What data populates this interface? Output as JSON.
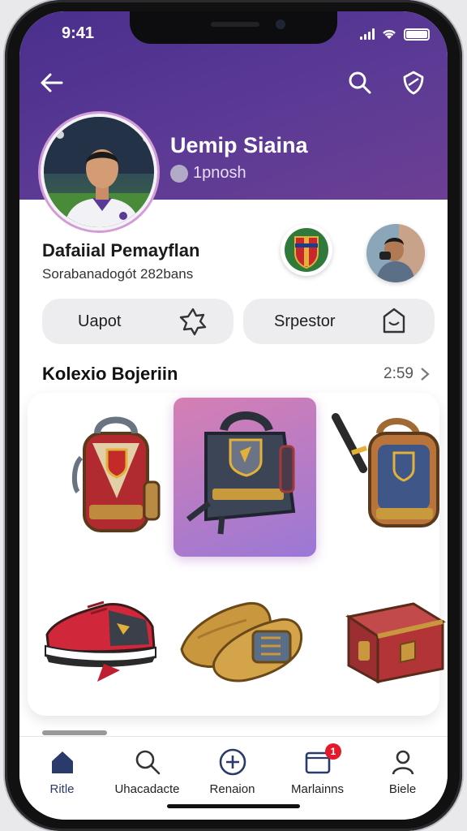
{
  "status_bar": {
    "time": "9:41"
  },
  "profile": {
    "name": "Uemip Siaina",
    "stat": "1pnosh"
  },
  "club": {
    "title": "Dafaiial Pemayflan",
    "subtitle": "Sorabanadogót 282bans"
  },
  "actions": {
    "left_label": "Uapot",
    "right_label": "Srpestor"
  },
  "collection": {
    "title": "Kolexio Bojeriin",
    "count": "2:59",
    "items": [
      {
        "name": "red-backpack",
        "selected": false
      },
      {
        "name": "dark-backpack",
        "selected": true
      },
      {
        "name": "blue-backpack",
        "selected": false
      },
      {
        "name": "red-sneaker",
        "selected": false
      },
      {
        "name": "gold-boots",
        "selected": false
      },
      {
        "name": "treasure-chest",
        "selected": false
      }
    ]
  },
  "tabbar": {
    "tabs": [
      {
        "label": "Ritle",
        "icon": "home-icon",
        "active": true
      },
      {
        "label": "Uhacadacte",
        "icon": "search-icon",
        "active": false
      },
      {
        "label": "Renaion",
        "icon": "plus-circle-icon",
        "active": false
      },
      {
        "label": "Marlainns",
        "icon": "inbox-icon",
        "active": false,
        "badge": "1"
      },
      {
        "label": "Biele",
        "icon": "person-icon",
        "active": false
      }
    ]
  },
  "colors": {
    "header_purple": "#5b3a95",
    "accent_navy": "#2a3a6b",
    "badge_red": "#e11b2b"
  }
}
